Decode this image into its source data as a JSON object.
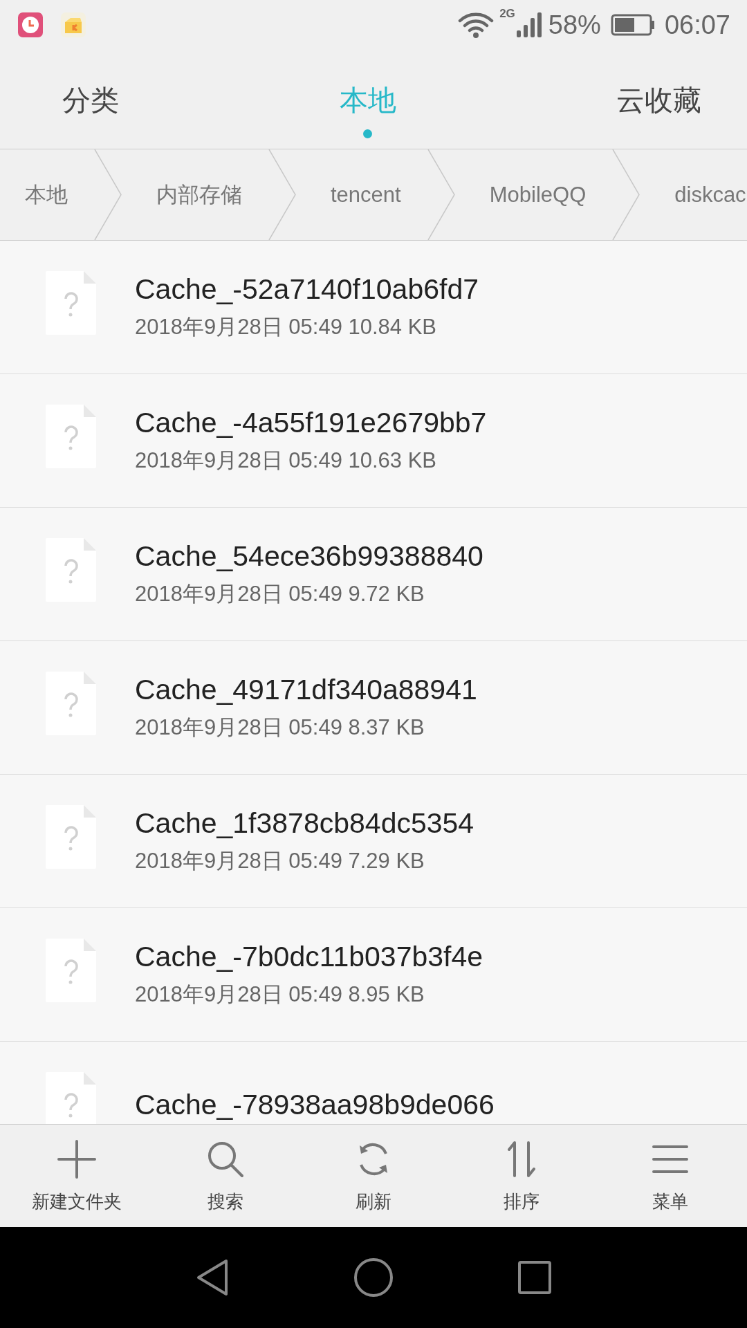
{
  "status_bar": {
    "network": "2G",
    "battery": "58%",
    "time": "06:07"
  },
  "tabs": [
    {
      "label": "分类",
      "selected": false
    },
    {
      "label": "本地",
      "selected": true
    },
    {
      "label": "云收藏",
      "selected": false
    }
  ],
  "breadcrumb": [
    "本地",
    "内部存储",
    "tencent",
    "MobileQQ",
    "diskcac"
  ],
  "files": [
    {
      "name": "Cache_-52a7140f10ab6fd7",
      "meta": "2018年9月28日 05:49 10.84 KB"
    },
    {
      "name": "Cache_-4a55f191e2679bb7",
      "meta": "2018年9月28日 05:49 10.63 KB"
    },
    {
      "name": "Cache_54ece36b99388840",
      "meta": "2018年9月28日 05:49 9.72 KB"
    },
    {
      "name": "Cache_49171df340a88941",
      "meta": "2018年9月28日 05:49 8.37 KB"
    },
    {
      "name": "Cache_1f3878cb84dc5354",
      "meta": "2018年9月28日 05:49 7.29 KB"
    },
    {
      "name": "Cache_-7b0dc11b037b3f4e",
      "meta": "2018年9月28日 05:49 8.95 KB"
    },
    {
      "name": "Cache_-78938aa98b9de066"
    }
  ],
  "toolbar": [
    {
      "kind": "add",
      "label": "新建文件夹"
    },
    {
      "kind": "search",
      "label": "搜索"
    },
    {
      "kind": "refresh",
      "label": "刷新"
    },
    {
      "kind": "sort",
      "label": "排序"
    },
    {
      "kind": "menu",
      "label": "菜单"
    }
  ]
}
